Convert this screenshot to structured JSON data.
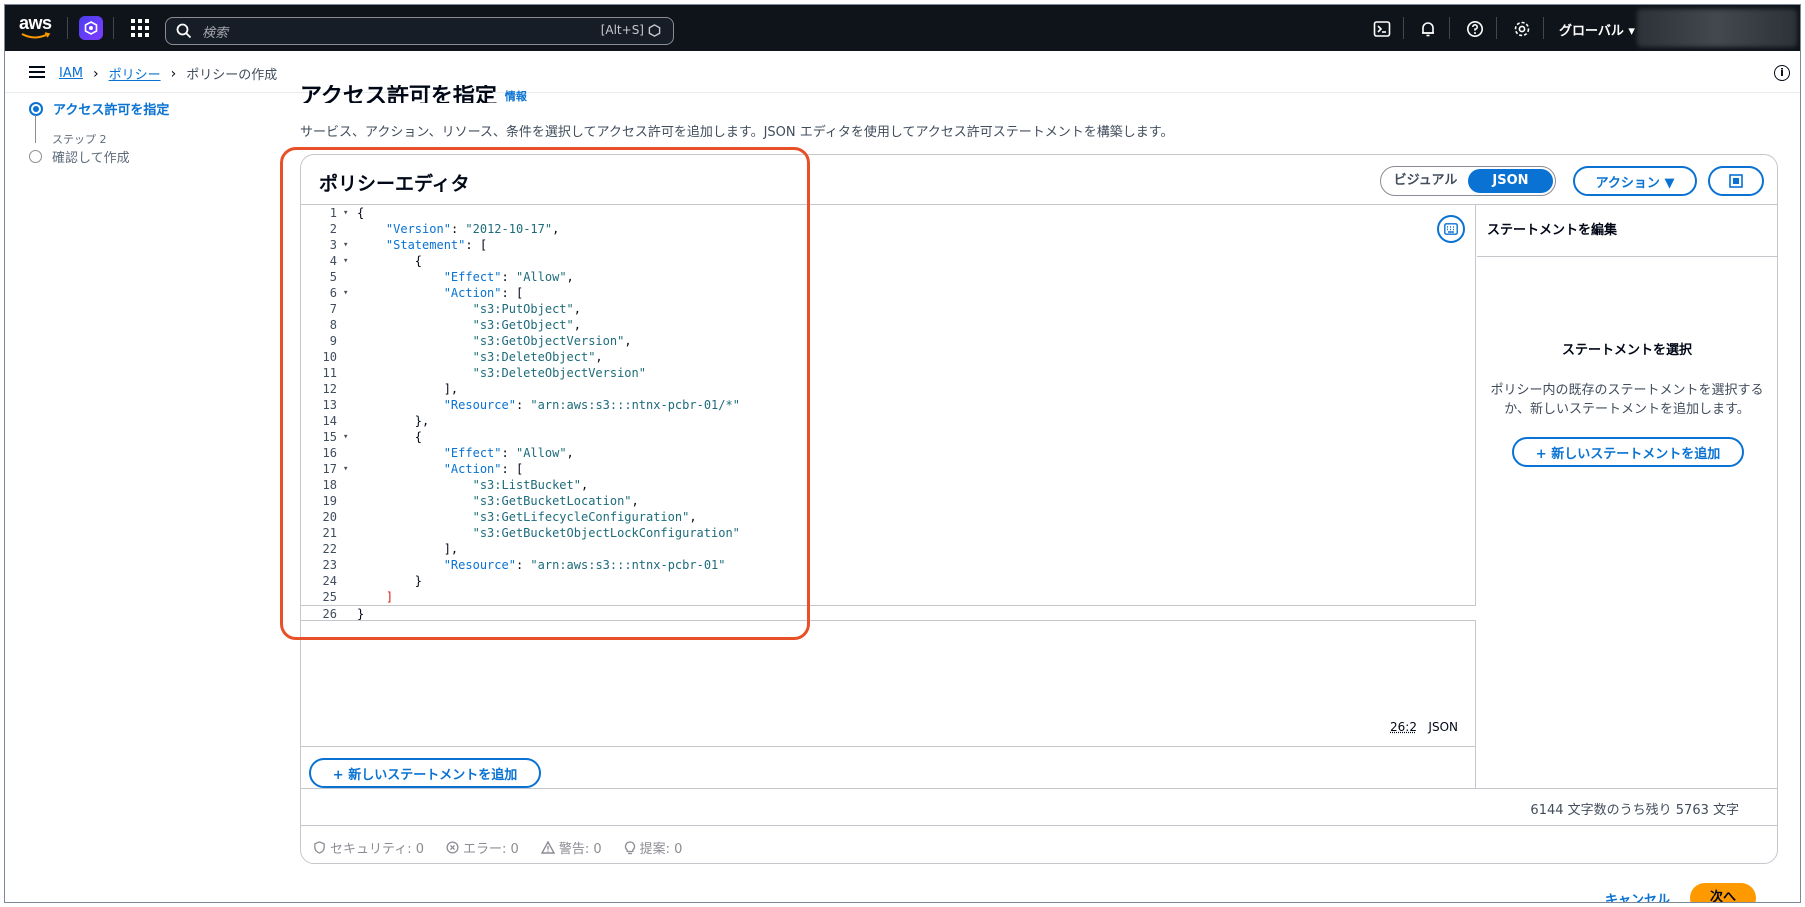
{
  "topnav": {
    "logo_text": "aws",
    "search_placeholder": "検索",
    "search_shortcut": "[Alt+S]",
    "region": "グローバル ▾"
  },
  "breadcrumb": {
    "items": [
      "IAM",
      "ポリシー",
      "ポリシーの作成"
    ]
  },
  "steps": {
    "step1_label": "アクセス許可を指定",
    "step2_sub": "ステップ 2",
    "step2_label": "確認して作成"
  },
  "page": {
    "title": "アクセス許可を指定",
    "info": "情報",
    "description": "サービス、アクション、リソース、条件を選択してアクセス許可を追加します。JSON エディタを使用してアクセス許可ステートメントを構築します。"
  },
  "editor_card": {
    "title": "ポリシーエディタ",
    "mode_visual": "ビジュアル",
    "mode_json": "JSON",
    "actions_button": "アクション ▼",
    "cursor_position": "26:2",
    "language": "JSON",
    "add_statement": "+ 新しいステートメントを追加",
    "char_count": "6144 文字数のうち残り 5763 文字"
  },
  "code_lines": [
    "{",
    "    \"Version\": \"2012-10-17\",",
    "    \"Statement\": [",
    "        {",
    "            \"Effect\": \"Allow\",",
    "            \"Action\": [",
    "                \"s3:PutObject\",",
    "                \"s3:GetObject\",",
    "                \"s3:GetObjectVersion\",",
    "                \"s3:DeleteObject\",",
    "                \"s3:DeleteObjectVersion\"",
    "            ],",
    "            \"Resource\": \"arn:aws:s3:::ntnx-pcbr-01/*\"",
    "        },",
    "        {",
    "            \"Effect\": \"Allow\",",
    "            \"Action\": [",
    "                \"s3:ListBucket\",",
    "                \"s3:GetBucketLocation\",",
    "                \"s3:GetLifecycleConfiguration\",",
    "                \"s3:GetBucketObjectLockConfiguration\"",
    "            ],",
    "            \"Resource\": \"arn:aws:s3:::ntnx-pcbr-01\"",
    "        }",
    "    ]",
    "}"
  ],
  "side_panel": {
    "header": "ステートメントを編集",
    "empty_title": "ステートメントを選択",
    "empty_desc": "ポリシー内の既存のステートメントを選択するか、新しいステートメントを追加します。",
    "add_statement": "+ 新しいステートメントを追加"
  },
  "validation": {
    "security": "セキュリティ: 0",
    "errors": "エラー: 0",
    "warnings": "警告: 0",
    "suggestions": "提案: 0"
  },
  "footer": {
    "cancel": "キャンセル",
    "next": "次へ"
  },
  "colors": {
    "accent": "#0972d3",
    "nav_bg": "#0f141a",
    "primary_button": "#ff9900",
    "highlight": "#e8502a"
  }
}
